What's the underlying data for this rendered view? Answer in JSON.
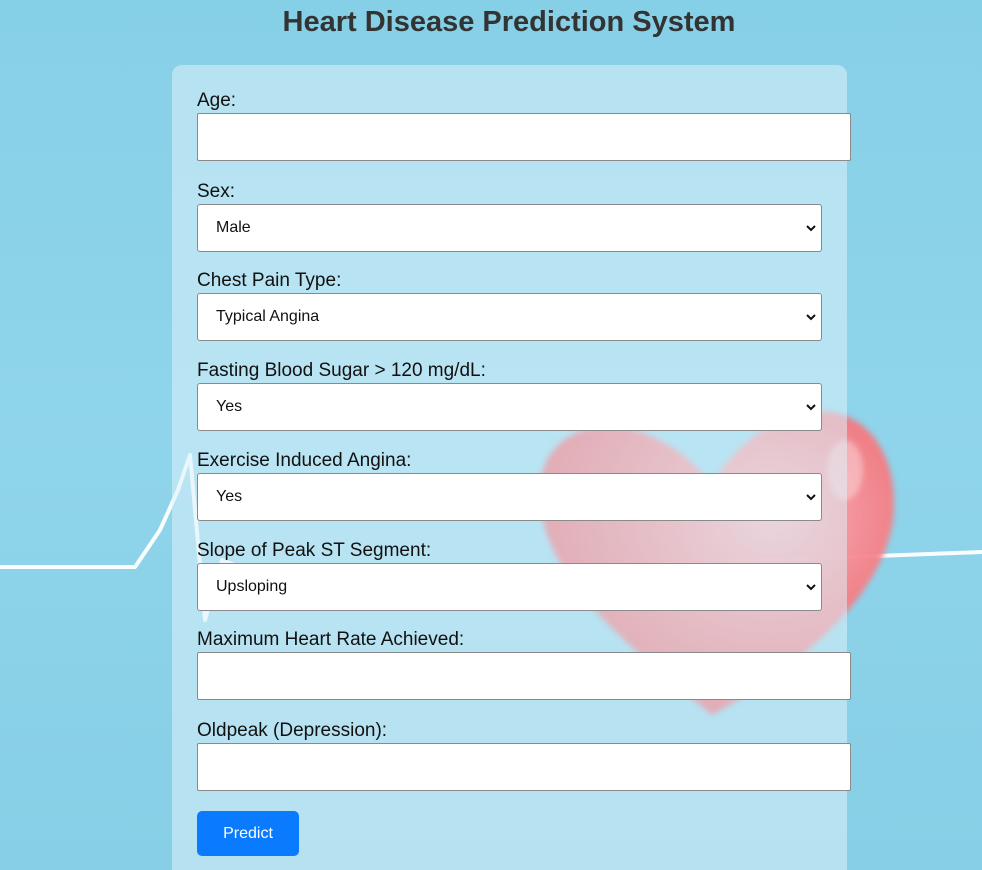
{
  "page": {
    "title": "Heart Disease Prediction System"
  },
  "form": {
    "age": {
      "label": "Age:",
      "value": ""
    },
    "sex": {
      "label": "Sex:",
      "value": "Male"
    },
    "chest_pain": {
      "label": "Chest Pain Type:",
      "value": "Typical Angina"
    },
    "fasting_blood_sugar": {
      "label": "Fasting Blood Sugar > 120 mg/dL:",
      "value": "Yes"
    },
    "exercise_angina": {
      "label": "Exercise Induced Angina:",
      "value": "Yes"
    },
    "slope": {
      "label": "Slope of Peak ST Segment:",
      "value": "Upsloping"
    },
    "max_heart_rate": {
      "label": "Maximum Heart Rate Achieved:",
      "value": ""
    },
    "oldpeak": {
      "label": "Oldpeak (Depression):",
      "value": ""
    },
    "submit_label": "Predict"
  },
  "icons": {
    "select_chevron": "chevron-down-icon",
    "background_heart": "heart-icon",
    "background_ecg": "ecg-line"
  },
  "colors": {
    "background": "#8ed1e8",
    "button": "#0a7bff",
    "title": "#333333",
    "heart": "#f0626a"
  }
}
